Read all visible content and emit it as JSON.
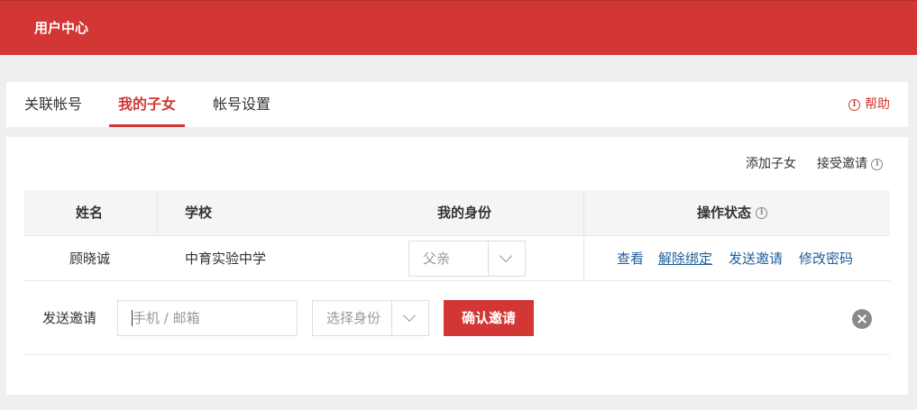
{
  "header": {
    "title": "用户中心"
  },
  "tabs": [
    {
      "label": "关联帐号",
      "active": false
    },
    {
      "label": "我的子女",
      "active": true
    },
    {
      "label": "帐号设置",
      "active": false
    }
  ],
  "help": {
    "label": "帮助",
    "icon": "info-circle-icon"
  },
  "toolbar": {
    "add_child": "添加子女",
    "accept_invite": "接受邀请"
  },
  "table": {
    "headers": {
      "name": "姓名",
      "school": "学校",
      "identity": "我的身份",
      "actions": "操作状态"
    },
    "rows": [
      {
        "name": "顾晓诚",
        "school": "中育实验中学",
        "identity": "父亲",
        "actions": [
          "查看",
          "解除绑定",
          "发送邀请",
          "修改密码"
        ]
      }
    ]
  },
  "invite": {
    "label": "发送邀请",
    "input_placeholder": "手机 / 邮箱",
    "identity_placeholder": "选择身份",
    "confirm": "确认邀请"
  },
  "colors": {
    "brand": "#d23735",
    "link": "#1f5e9b"
  }
}
